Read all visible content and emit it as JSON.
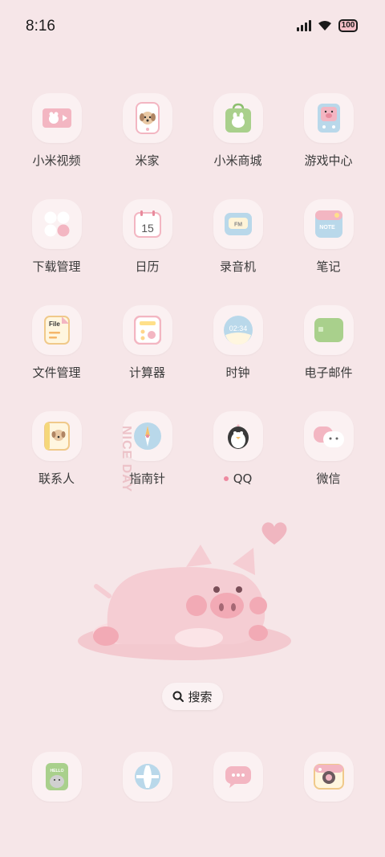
{
  "status_bar": {
    "time": "8:16",
    "battery": "100"
  },
  "apps": [
    {
      "label": "小米视频"
    },
    {
      "label": "米家"
    },
    {
      "label": "小米商城"
    },
    {
      "label": "游戏中心"
    },
    {
      "label": "下载管理"
    },
    {
      "label": "日历",
      "icon_text": "15"
    },
    {
      "label": "录音机",
      "icon_text": "FM"
    },
    {
      "label": "笔记",
      "icon_text": "NOTE"
    },
    {
      "label": "文件管理",
      "icon_text": "File"
    },
    {
      "label": "计算器"
    },
    {
      "label": "时钟",
      "icon_text": "02:34"
    },
    {
      "label": "电子邮件"
    },
    {
      "label": "联系人"
    },
    {
      "label": "指南针"
    },
    {
      "label": "QQ"
    },
    {
      "label": "微信"
    }
  ],
  "wallpaper": {
    "text": "NICE DAY"
  },
  "search": {
    "label": "搜索"
  },
  "dock": [
    {
      "name": "gallery",
      "icon_text": "HELLO"
    },
    {
      "name": "browser"
    },
    {
      "name": "messages"
    },
    {
      "name": "camera"
    }
  ],
  "colors": {
    "background": "#f6e6e8",
    "tile": "#fbf1f2",
    "accent_pink": "#f3b6c2",
    "accent_green": "#a9d08c",
    "accent_blue": "#b9d8ea"
  }
}
